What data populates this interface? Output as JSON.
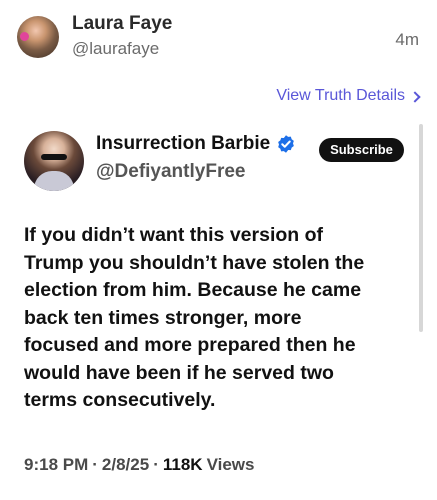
{
  "post": {
    "author_name": "Laura Faye",
    "author_handle": "@laurafaye",
    "age": "4m",
    "details_link": "View Truth Details"
  },
  "embedded": {
    "name": "Insurrection Barbie",
    "handle": "@DefiyantlyFree",
    "subscribe_label": "Subscribe",
    "body": "If you didn’t want this version of\nTrump you shouldn’t have stolen the\nelection from him. Because he came\nback ten times stronger, more\nfocused and more prepared then he\nwould have been if he served two\nterms consecutively.",
    "time": "9:18 PM",
    "date": "2/8/25",
    "views_count": "118K",
    "views_label": "Views",
    "sep": "·"
  },
  "colors": {
    "link": "#5a57d8",
    "verified": "#1d6fe8"
  },
  "icons": {
    "chevron": "chevron-right-icon",
    "verified": "verified-badge-icon"
  }
}
